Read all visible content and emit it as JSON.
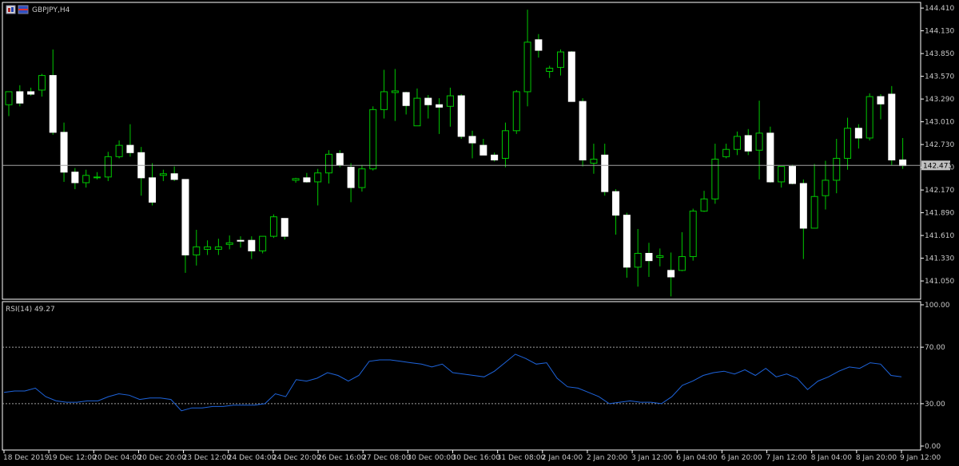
{
  "chart_title": "GBPJPY,H4",
  "colors": {
    "background": "#000000",
    "bull_candle": "#00c800",
    "bear_candle": "#ffffff",
    "bid_line": "#a0a0a0",
    "rsi_line": "#1e64dc",
    "axis_text": "#c8c8c8"
  },
  "chart_data": [
    {
      "type": "candlestick",
      "title": "GBPJPY,H4",
      "ylim": [
        140.825,
        144.48
      ],
      "y_ticks": [
        "144.410",
        "144.130",
        "143.850",
        "143.570",
        "143.290",
        "143.010",
        "142.730",
        "142.450",
        "142.170",
        "141.890",
        "141.610",
        "141.330",
        "141.050"
      ],
      "current_price_label": "142.473",
      "current_price": 142.473,
      "x_ticks": [
        "18 Dec 2019",
        "19 Dec 12:00",
        "20 Dec 04:00",
        "20 Dec 20:00",
        "23 Dec 12:00",
        "24 Dec 04:00",
        "24 Dec 20:00",
        "26 Dec 16:00",
        "27 Dec 08:00",
        "30 Dec 00:00",
        "30 Dec 16:00",
        "31 Dec 08:00",
        "2 Jan 04:00",
        "2 Jan 20:00",
        "3 Jan 12:00",
        "6 Jan 04:00",
        "6 Jan 20:00",
        "7 Jan 12:00",
        "8 Jan 04:00",
        "8 Jan 20:00",
        "9 Jan 12:00"
      ],
      "ohlc": [
        [
          143.22,
          143.38,
          143.08,
          143.38
        ],
        [
          143.38,
          143.46,
          143.2,
          143.24
        ],
        [
          143.38,
          143.43,
          143.33,
          143.35
        ],
        [
          143.4,
          143.6,
          143.32,
          143.58
        ],
        [
          143.58,
          143.9,
          142.85,
          142.88
        ],
        [
          142.88,
          143.0,
          142.27,
          142.39
        ],
        [
          142.39,
          142.44,
          142.18,
          142.26
        ],
        [
          142.26,
          142.42,
          142.2,
          142.35
        ],
        [
          142.33,
          142.39,
          142.3,
          142.33
        ],
        [
          142.33,
          142.64,
          142.28,
          142.58
        ],
        [
          142.58,
          142.78,
          142.56,
          142.72
        ],
        [
          142.72,
          142.98,
          142.58,
          142.63
        ],
        [
          142.63,
          142.7,
          142.1,
          142.32
        ],
        [
          142.32,
          142.5,
          141.98,
          142.02
        ],
        [
          142.35,
          142.42,
          142.28,
          142.37
        ],
        [
          142.37,
          142.46,
          142.28,
          142.3
        ],
        [
          142.3,
          142.3,
          141.15,
          141.37
        ],
        [
          141.37,
          141.68,
          141.24,
          141.47
        ],
        [
          141.44,
          141.55,
          141.37,
          141.47
        ],
        [
          141.44,
          141.57,
          141.37,
          141.47
        ],
        [
          141.5,
          141.61,
          141.44,
          141.52
        ],
        [
          141.55,
          141.6,
          141.46,
          141.54
        ],
        [
          141.55,
          141.6,
          141.32,
          141.42
        ],
        [
          141.42,
          141.6,
          141.39,
          141.6
        ],
        [
          141.6,
          141.87,
          141.58,
          141.84
        ],
        [
          141.82,
          141.82,
          141.56,
          141.6
        ],
        [
          142.29,
          142.32,
          142.26,
          142.31
        ],
        [
          142.32,
          142.38,
          142.26,
          142.27
        ],
        [
          142.27,
          142.43,
          141.98,
          142.38
        ],
        [
          142.38,
          142.66,
          142.25,
          142.61
        ],
        [
          142.62,
          142.66,
          142.45,
          142.48
        ],
        [
          142.45,
          142.5,
          142.02,
          142.2
        ],
        [
          142.2,
          142.48,
          142.15,
          142.43
        ],
        [
          142.43,
          143.2,
          142.41,
          143.16
        ],
        [
          143.16,
          143.65,
          143.05,
          143.38
        ],
        [
          143.37,
          143.66,
          143.02,
          143.39
        ],
        [
          143.37,
          143.38,
          143.1,
          143.21
        ],
        [
          142.96,
          143.42,
          142.96,
          143.3
        ],
        [
          143.3,
          143.34,
          143.05,
          143.22
        ],
        [
          143.22,
          143.3,
          142.86,
          143.19
        ],
        [
          143.2,
          143.43,
          142.95,
          143.33
        ],
        [
          143.33,
          143.35,
          142.8,
          142.83
        ],
        [
          142.83,
          142.9,
          142.56,
          142.75
        ],
        [
          142.72,
          142.8,
          142.6,
          142.6
        ],
        [
          142.6,
          142.63,
          142.52,
          142.54
        ],
        [
          142.56,
          143.0,
          142.45,
          142.9
        ],
        [
          142.9,
          143.4,
          142.86,
          143.38
        ],
        [
          143.38,
          144.39,
          143.2,
          143.99
        ],
        [
          144.02,
          144.09,
          143.8,
          143.89
        ],
        [
          143.63,
          143.7,
          143.55,
          143.67
        ],
        [
          143.68,
          143.9,
          143.58,
          143.87
        ],
        [
          143.87,
          143.88,
          143.28,
          143.26
        ],
        [
          143.26,
          143.3,
          142.46,
          142.54
        ],
        [
          142.5,
          142.74,
          142.37,
          142.55
        ],
        [
          142.6,
          142.74,
          142.1,
          142.15
        ],
        [
          142.15,
          142.18,
          141.62,
          141.86
        ],
        [
          141.86,
          141.89,
          141.09,
          141.22
        ],
        [
          141.22,
          141.69,
          140.98,
          141.39
        ],
        [
          141.39,
          141.52,
          141.1,
          141.3
        ],
        [
          141.34,
          141.45,
          141.23,
          141.36
        ],
        [
          141.18,
          141.4,
          140.86,
          141.1
        ],
        [
          141.18,
          141.65,
          141.17,
          141.35
        ],
        [
          141.35,
          141.94,
          141.3,
          141.91
        ],
        [
          141.91,
          142.16,
          141.9,
          142.06
        ],
        [
          142.06,
          142.74,
          142.0,
          142.55
        ],
        [
          142.58,
          142.74,
          142.56,
          142.67
        ],
        [
          142.67,
          142.89,
          142.6,
          142.83
        ],
        [
          142.84,
          142.92,
          142.6,
          142.65
        ],
        [
          142.66,
          143.27,
          142.3,
          142.87
        ],
        [
          142.87,
          142.95,
          142.26,
          142.27
        ],
        [
          142.27,
          142.44,
          142.2,
          142.46
        ],
        [
          142.46,
          142.48,
          142.24,
          142.25
        ],
        [
          142.25,
          142.3,
          141.32,
          141.7
        ],
        [
          141.7,
          142.49,
          141.7,
          142.09
        ],
        [
          142.1,
          142.53,
          141.93,
          142.29
        ],
        [
          142.29,
          142.8,
          142.13,
          142.56
        ],
        [
          142.56,
          143.06,
          142.42,
          142.93
        ],
        [
          142.93,
          142.98,
          142.68,
          142.81
        ],
        [
          142.81,
          143.36,
          142.78,
          143.32
        ],
        [
          143.32,
          143.35,
          143.04,
          143.23
        ],
        [
          143.35,
          143.45,
          142.47,
          142.54
        ],
        [
          142.54,
          142.81,
          142.43,
          142.47
        ]
      ]
    },
    {
      "type": "line",
      "title": "RSI(14) 49.27",
      "ylim": [
        0,
        100
      ],
      "y_ticks": [
        "100.00",
        "70.00",
        "30.00",
        "0.00"
      ],
      "levels": [
        70,
        30
      ],
      "series": [
        {
          "name": "RSI(14)",
          "values": [
            38,
            39,
            39,
            41,
            35,
            32,
            31,
            31,
            32,
            32,
            35,
            37,
            36,
            33,
            34,
            34,
            33,
            25,
            27,
            27,
            28,
            28,
            29,
            29,
            29,
            30,
            37,
            35,
            47,
            46,
            48,
            52,
            50,
            46,
            50,
            60,
            61,
            61,
            60,
            59,
            58,
            56,
            58,
            52,
            51,
            50,
            49,
            53,
            59,
            65,
            62,
            58,
            59,
            48,
            42,
            41,
            38,
            35,
            30,
            31,
            32,
            31,
            31,
            30,
            35,
            43,
            46,
            50,
            52,
            53,
            51,
            54,
            50,
            55,
            49,
            51,
            48,
            40,
            46,
            49,
            53,
            56,
            55,
            59,
            58,
            50,
            49
          ]
        }
      ]
    }
  ]
}
